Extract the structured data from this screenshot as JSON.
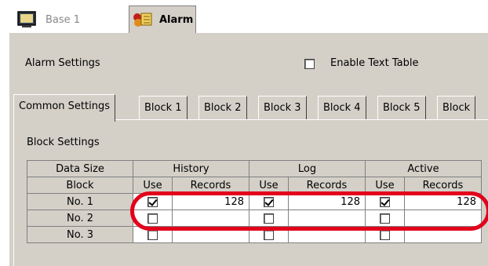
{
  "tabs": [
    {
      "label": "Base 1",
      "icon": "screen-icon",
      "active": false
    },
    {
      "label": "Alarm",
      "icon": "alarm-icon",
      "active": true
    }
  ],
  "alarm_settings": {
    "label": "Alarm Settings",
    "enable_text_table": {
      "label": "Enable Text Table",
      "checked": false
    }
  },
  "settings_tabs": [
    "Common Settings",
    "Block 1",
    "Block 2",
    "Block 3",
    "Block 4",
    "Block 5",
    "Block"
  ],
  "block_settings": {
    "label": "Block Settings",
    "header1": {
      "data_size": "Data Size",
      "history": "History",
      "log": "Log",
      "active": "Active"
    },
    "header2": {
      "block": "Block",
      "use1": "Use",
      "rec1": "Records",
      "use2": "Use",
      "rec2": "Records",
      "use3": "Use",
      "rec3": "Records"
    },
    "rows": [
      {
        "block": "No. 1",
        "history_use": true,
        "history_records": "128",
        "log_use": true,
        "log_records": "128",
        "active_use": true,
        "active_records": "128"
      },
      {
        "block": "No. 2",
        "history_use": false,
        "history_records": "",
        "log_use": false,
        "log_records": "",
        "active_use": false,
        "active_records": ""
      },
      {
        "block": "No. 3",
        "history_use": false,
        "history_records": "",
        "log_use": false,
        "log_records": "",
        "active_use": false,
        "active_records": ""
      }
    ]
  },
  "colors": {
    "highlight": "#e3001b",
    "window": "#d4d0c8"
  }
}
